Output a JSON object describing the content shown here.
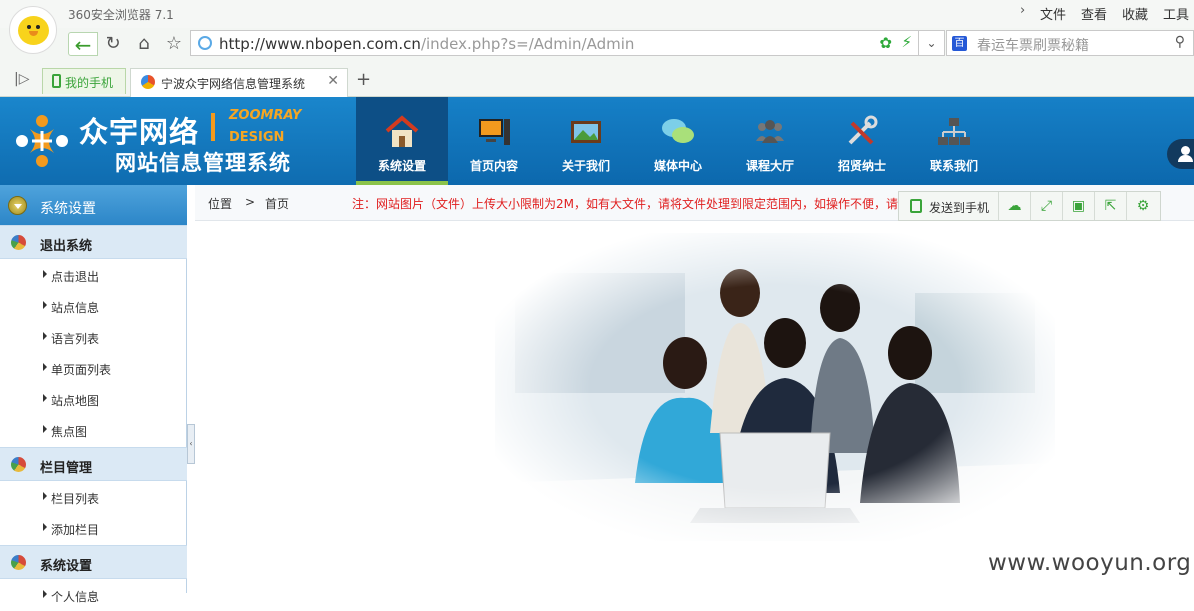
{
  "browser": {
    "name": "360安全浏览器 7.1",
    "menu": [
      "文件",
      "查看",
      "收藏",
      "工具"
    ],
    "url_host": "http://www.nbopen.com.cn",
    "url_path": "/index.php?s=/Admin/Admin",
    "search_placeholder": "春运车票刷票秘籍",
    "tabs": [
      {
        "label": "我的手机"
      },
      {
        "label": "宁波众宇网络信息管理系统"
      }
    ]
  },
  "site": {
    "brand_title": "众宇网络",
    "brand_en1": "ZOOMRAY",
    "brand_en2": "DESIGN",
    "brand_sub": "网站信息管理系统",
    "nav": [
      {
        "label": "系统设置",
        "icon": "home-icon"
      },
      {
        "label": "首页内容",
        "icon": "monitor-icon"
      },
      {
        "label": "关于我们",
        "icon": "picture-icon"
      },
      {
        "label": "媒体中心",
        "icon": "chat-bubbles-icon"
      },
      {
        "label": "课程大厅",
        "icon": "group-icon"
      },
      {
        "label": "招贤纳士",
        "icon": "tools-icon"
      },
      {
        "label": "联系我们",
        "icon": "network-icon"
      }
    ],
    "accent": "#0c68ad",
    "active_nav_underline": "#8bc34a"
  },
  "sidebar": {
    "header": "系统设置",
    "groups": [
      {
        "label": "退出系统",
        "items": [
          "点击退出",
          "站点信息",
          "语言列表",
          "单页面列表",
          "站点地图",
          "焦点图"
        ]
      },
      {
        "label": "栏目管理",
        "items": [
          "栏目列表",
          "添加栏目"
        ]
      },
      {
        "label": "系统设置",
        "items": [
          "个人信息"
        ]
      }
    ]
  },
  "content": {
    "crumb_pos": "位置",
    "crumb_sep": ">",
    "crumb_home": "首页",
    "notice": "注：网站图片（文件）上传大小限制为2M，如有大文件，请将文件处理到限定范围内，如操作不便，请",
    "notice_color": "#e02020"
  },
  "toolbar": {
    "send_label": "发送到手机",
    "buttons": [
      "cloud-icon",
      "fullscreen-icon",
      "save-icon",
      "share-icon",
      "settings-icon"
    ]
  },
  "watermark": "www.wooyun.org"
}
